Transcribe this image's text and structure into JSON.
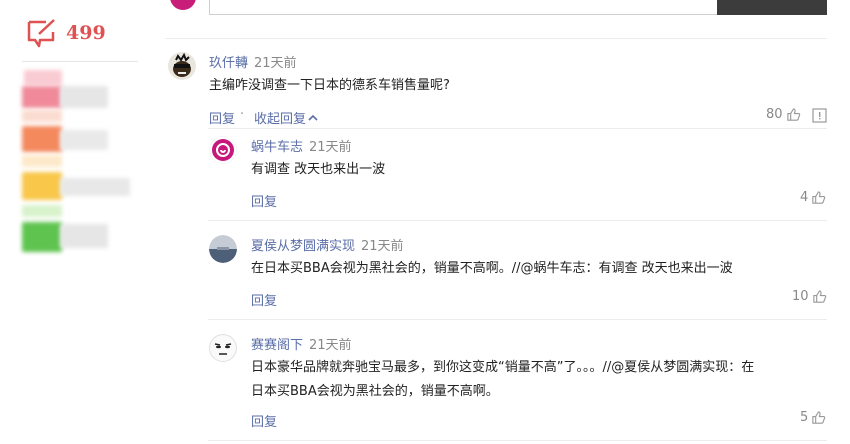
{
  "sidebar": {
    "comment_count": "499",
    "accent": "#e05252"
  },
  "main_comment": {
    "user": "玖仟轉",
    "time": "21天前",
    "text": "主编咋没调查一下日本的德系车销售量呢?",
    "reply_label": "回复",
    "collapse_label": "收起回复",
    "likes": "80"
  },
  "replies": [
    {
      "user": "蜗牛车志",
      "time": "21天前",
      "text": "有调查 改天也来出一波",
      "reply_label": "回复",
      "likes": "4"
    },
    {
      "user": "夏侯从梦圆满实现",
      "time": "21天前",
      "text": "在日本买BBA会视为黑社会的，销量不高啊。//@蜗牛车志：有调查 改天也来出一波",
      "reply_label": "回复",
      "likes": "10"
    },
    {
      "user": "赛赛阁下",
      "time": "21天前",
      "text_line1": "日本豪华品牌就奔驰宝马最多，到你这变成“销量不高”了。。。//@夏侯从梦圆满实现：在",
      "text_line2": "日本买BBA会视为黑社会的，销量不高啊。",
      "reply_label": "回复",
      "likes": "5"
    }
  ]
}
